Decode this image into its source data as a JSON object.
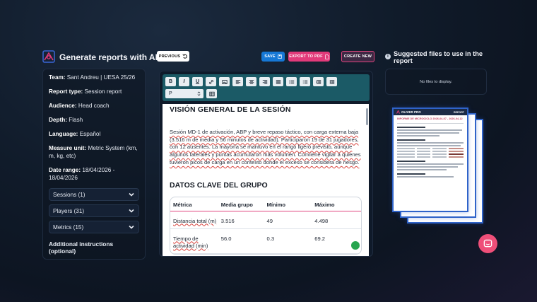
{
  "app": {
    "title": "Generate reports with AI"
  },
  "left_panel": {
    "team_label": "Team:",
    "team_value": "Sant Andreu | UESA 25/26",
    "report_type_label": "Report type:",
    "report_type_value": "Session report",
    "audience_label": "Audience:",
    "audience_value": "Head coach",
    "depth_label": "Depth:",
    "depth_value": "Flash",
    "language_label": "Language:",
    "language_value": "Español",
    "measure_label": "Measure unit:",
    "measure_value": "Metric System (km, m, kg, etc)",
    "date_label": "Date range:",
    "date_value": "18/04/2026 - 18/04/2026",
    "sessions": "Sessions (1)",
    "players": "Players (31)",
    "metrics": "Metrics (15)",
    "additional_title": "Additional instructions (optional)",
    "additional_value": "-"
  },
  "buttons": {
    "previous": "PREVIOUS",
    "save": "SAVE",
    "export_pdf": "EXPORT TO PDF",
    "create_new": "CREATE NEW"
  },
  "editor": {
    "format_select": "P",
    "doc_heading": "VISIÓN GENERAL DE LA SESIÓN",
    "doc_paragraph": "Sesión MD-1 de activación, ABP y breve repaso táctico, con carga externa baja (3.516 m de media y 56 minutos de actividad). Participaron 19 de 31 jugadores, con 12 ausentes. La mayoría se mantuvo en el rango ligero previsto, aunque algunos laterales y puntas acumularon más volumen. Conviene vigilar a quienes tuvieron picos de carga en un contexto donde el exceso se considera de riesgo.",
    "doc_subheading": "DATOS CLAVE DEL GRUPO",
    "table_headers": [
      "Métrica",
      "Media grupo",
      "Mínimo",
      "Máximo"
    ],
    "table_rows": [
      [
        "Distancia total (m)",
        "3.516",
        "49",
        "4.498"
      ],
      [
        "Tiempo de actividad (min)",
        "56.0",
        "0.3",
        "69.2"
      ]
    ]
  },
  "right_panel": {
    "title": "Suggested files to use in the report",
    "no_files": "No files to display.",
    "preview_logo": "OLIVER PRO",
    "preview_tag": "REPORT",
    "preview_title": "INFORME DE MICROCICLO 2026-04-07 - 2026-04-12"
  },
  "colors": {
    "accent_pink": "#e23a7a",
    "accent_blue": "#1678d6",
    "toolbar_teal": "#1b5a66",
    "fab": "#ef4f79"
  }
}
